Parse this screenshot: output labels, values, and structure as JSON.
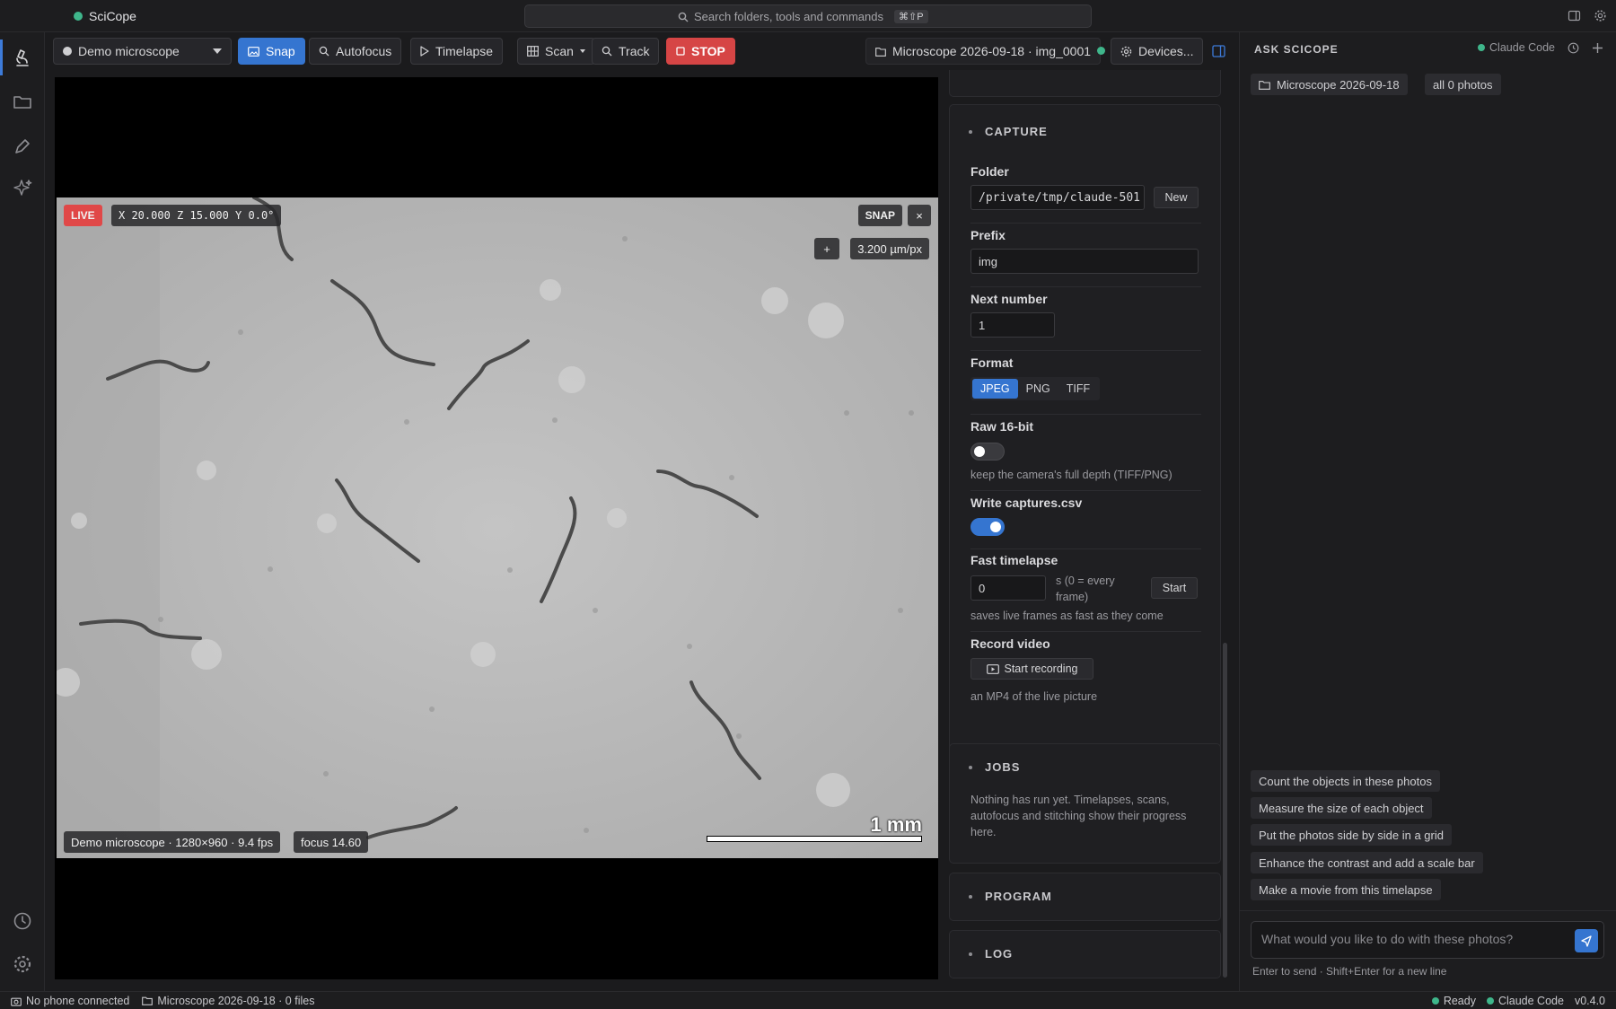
{
  "app": {
    "name": "SciCope"
  },
  "command_search": {
    "placeholder": "Search folders, tools and commands",
    "shortcut": "⌘⇧P"
  },
  "toolbar": {
    "device": "Demo microscope",
    "snap": "Snap",
    "autofocus": "Autofocus",
    "timelapse": "Timelapse",
    "scan": "Scan",
    "track": "Track",
    "stop": "STOP",
    "session": "Microscope 2026-09-18 · img_0001",
    "devices": "Devices..."
  },
  "viewer": {
    "live": "LIVE",
    "coords": "X 20.000 Z 15.000 Y 0.0°",
    "snap": "SNAP",
    "close": "×",
    "zoom_in": "+",
    "pixel_scale": "3.200 µm/px",
    "info": "Demo microscope · 1280×960 · 9.4 fps",
    "focus": "focus 14.60",
    "scale_bar_label": "1 mm"
  },
  "capture": {
    "title": "CAPTURE",
    "folder_label": "Folder",
    "folder_value": "/private/tmp/claude-501",
    "folder_new": "New",
    "prefix_label": "Prefix",
    "prefix_value": "img",
    "next_label": "Next number",
    "next_value": "1",
    "format_label": "Format",
    "formats": [
      "JPEG",
      "PNG",
      "TIFF"
    ],
    "format_selected": "JPEG",
    "raw_label": "Raw 16-bit",
    "raw_on": false,
    "raw_hint": "keep the camera's full depth (TIFF/PNG)",
    "csv_label": "Write captures.csv",
    "csv_on": true,
    "fast_label": "Fast timelapse",
    "fast_value": "0",
    "fast_unit": "s (0 = every frame)",
    "fast_start": "Start",
    "fast_hint": "saves live frames as fast as they come",
    "video_label": "Record video",
    "video_button": "Start recording",
    "video_hint": "an MP4 of the live picture"
  },
  "jobs": {
    "title": "JOBS",
    "empty": "Nothing has run yet. Timelapses, scans, autofocus and stitching show their progress here."
  },
  "program": {
    "title": "PROGRAM"
  },
  "log": {
    "title": "LOG"
  },
  "ask": {
    "title": "ASK SCICOPE",
    "model": "Claude Code",
    "context_folder": "Microscope 2026-09-18",
    "context_photos": "all 0 photos",
    "suggestions": [
      "Count the objects in these photos",
      "Measure the size of each object",
      "Put the photos side by side in a grid",
      "Enhance the contrast and add a scale bar",
      "Make a movie from this timelapse"
    ],
    "input_placeholder": "What would you like to do with these photos?",
    "hint": "Enter to send · Shift+Enter for a new line"
  },
  "statusbar": {
    "phone": "No phone connected",
    "folder": "Microscope 2026-09-18 · 0 files",
    "ready": "Ready",
    "model": "Claude Code",
    "version": "v0.4.0"
  }
}
